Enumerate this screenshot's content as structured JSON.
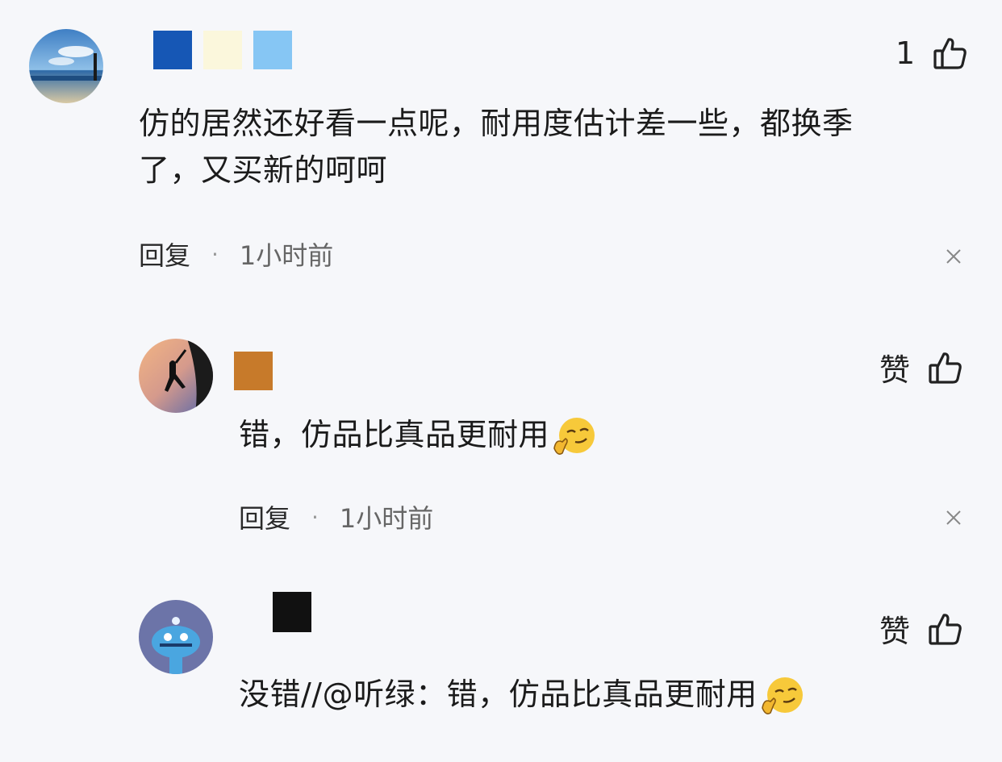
{
  "comments": [
    {
      "like_label": "1",
      "text_line1": "仿的居然还好看一点呢，耐用度估计差一些，都换季",
      "text_line2": "了，又买新的呵呵",
      "reply_label": "回复",
      "separator": "·",
      "time": "1小时前",
      "name_colors": [
        "#1657b5",
        "#fbf7dc",
        "#86c6f4"
      ]
    },
    {
      "like_label": "赞",
      "text": "错，仿品比真品更耐用",
      "reply_label": "回复",
      "separator": "·",
      "time": "1小时前",
      "name_colors": [
        "#c77a2a"
      ]
    },
    {
      "like_label": "赞",
      "text": "没错//@听绿：错，仿品比真品更耐用",
      "name_colors": [
        "#111111"
      ]
    }
  ],
  "icons": {
    "like": "thumbs-up-icon",
    "close": "close-icon",
    "emoji": "smirk-emoji-icon"
  }
}
